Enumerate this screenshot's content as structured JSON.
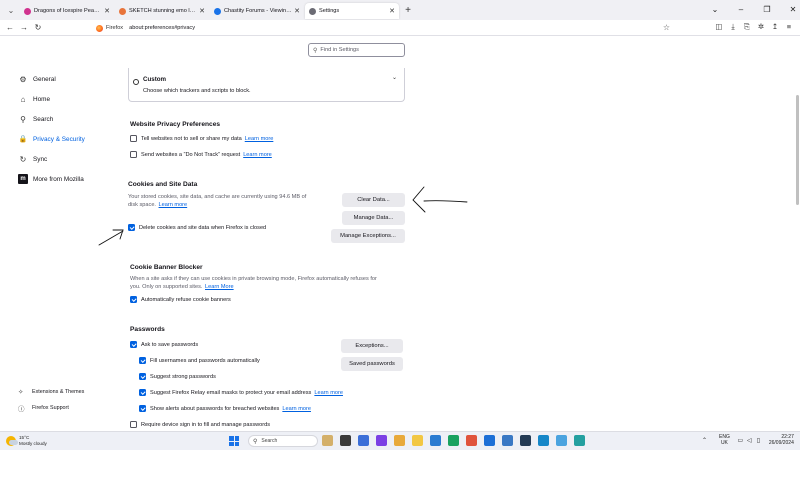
{
  "tabs": [
    {
      "label": "Dragons of Icespire Peak | Roll",
      "color": "#d0328e",
      "active": false
    },
    {
      "label": "SKETCH stunning emo lady bu",
      "color": "#e8743b",
      "active": false
    },
    {
      "label": "Chastity Forums - Viewing pro",
      "color": "#1a73e8",
      "active": false
    },
    {
      "label": "Settings",
      "color": "#6b6b74",
      "active": true
    }
  ],
  "window_controls": {
    "minimize": "–",
    "restore": "❐",
    "close": "✕"
  },
  "navbar": {
    "brand": "Firefox",
    "url": "about:preferences#privacy"
  },
  "search": {
    "placeholder": "Find in Settings"
  },
  "sidebar": {
    "items": [
      {
        "label": "General",
        "icon": "gear-icon",
        "glyph": "⚙"
      },
      {
        "label": "Home",
        "icon": "home-icon",
        "glyph": "⌂"
      },
      {
        "label": "Search",
        "icon": "search-icon",
        "glyph": "⚲"
      },
      {
        "label": "Privacy & Security",
        "icon": "lock-icon",
        "glyph": "🔒"
      },
      {
        "label": "Sync",
        "icon": "sync-icon",
        "glyph": "↻"
      },
      {
        "label": "More from Mozilla",
        "icon": "mozilla-icon",
        "glyph": "m"
      }
    ],
    "footer": [
      {
        "label": "Extensions & Themes",
        "icon": "puzzle-icon",
        "glyph": "✧"
      },
      {
        "label": "Firefox Support",
        "icon": "help-icon",
        "glyph": "ⓘ"
      }
    ]
  },
  "custom": {
    "title": "Custom",
    "description": "Choose which trackers and scripts to block."
  },
  "website_privacy": {
    "title": "Website Privacy Preferences",
    "items": [
      {
        "label": "Tell websites not to sell or share my data",
        "link": "Learn more",
        "checked": false
      },
      {
        "label": "Send websites a “Do Not Track” request",
        "link": "Learn more",
        "checked": false
      }
    ]
  },
  "cookies": {
    "title": "Cookies and Site Data",
    "description_1": "Your stored cookies, site data, and cache are currently using 94.6 MB of",
    "description_2": "disk space.",
    "learn_more": "Learn more",
    "clear_button": "Clear Data...",
    "manage_button": "Manage Data...",
    "exceptions_button": "Manage Exceptions...",
    "delete_on_close": {
      "label": "Delete cookies and site data when Firefox is closed",
      "checked": true
    }
  },
  "cookie_banner": {
    "title": "Cookie Banner Blocker",
    "description_1": "When a site asks if they can use cookies in private browsing mode, Firefox automatically refuses for",
    "description_2": "you. Only on supported sites.",
    "learn_more": "Learn More",
    "auto_refuse": {
      "label": "Automatically refuse cookie banners",
      "checked": true
    }
  },
  "passwords": {
    "title": "Passwords",
    "ask_to_save": {
      "label": "Ask to save passwords",
      "checked": true
    },
    "exceptions_button": "Exceptions...",
    "saved_button": "Saved passwords",
    "fill_auto": {
      "label": "Fill usernames and passwords automatically",
      "checked": true
    },
    "suggest_strong": {
      "label": "Suggest strong passwords",
      "checked": true
    },
    "relay": {
      "label": "Suggest Firefox Relay email masks to protect your email address",
      "link": "Learn more",
      "checked": true
    },
    "breach_alerts": {
      "label": "Show alerts about passwords for breached websites",
      "link": "Learn more",
      "checked": true
    },
    "device_signin": {
      "label": "Require device sign in to fill and manage passwords",
      "checked": false
    }
  },
  "taskbar": {
    "temperature": "15°C",
    "weather": "Mostly cloudy",
    "search_placeholder": "Search",
    "lang_1": "ENG",
    "lang_2": "UK",
    "time": "22:27",
    "date": "26/09/2024",
    "apps": [
      "#d4b06a",
      "#3a3a3a",
      "#3c6fd8",
      "#7b3fe4",
      "#e8a93b",
      "#f2c744",
      "#2b7bd1",
      "#1aa260",
      "#e0533c",
      "#1d6fd6",
      "#3a78c4",
      "#243b55",
      "#1687c8",
      "#4aa3df",
      "#24a0a0"
    ],
    "colors": {
      "accent": "#0061e0"
    }
  }
}
